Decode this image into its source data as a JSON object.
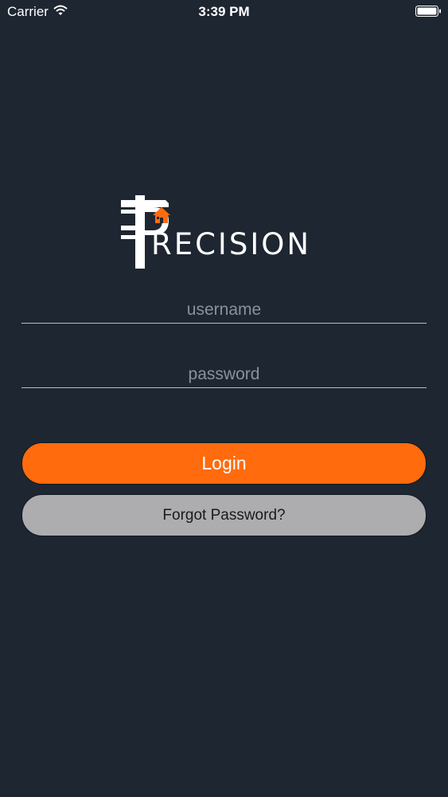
{
  "status_bar": {
    "carrier": "Carrier",
    "time": "3:39 PM",
    "wifi_icon": "wifi-icon",
    "battery_icon": "battery-icon"
  },
  "logo": {
    "initial": "P",
    "text": "RECISION",
    "accent_color": "#ff6b0d"
  },
  "form": {
    "username_placeholder": "username",
    "username_value": "",
    "password_placeholder": "password",
    "password_value": ""
  },
  "buttons": {
    "login_label": "Login",
    "forgot_label": "Forgot Password?"
  },
  "colors": {
    "background": "#1e2631",
    "primary": "#ff6b0d",
    "secondary": "#adacae"
  }
}
